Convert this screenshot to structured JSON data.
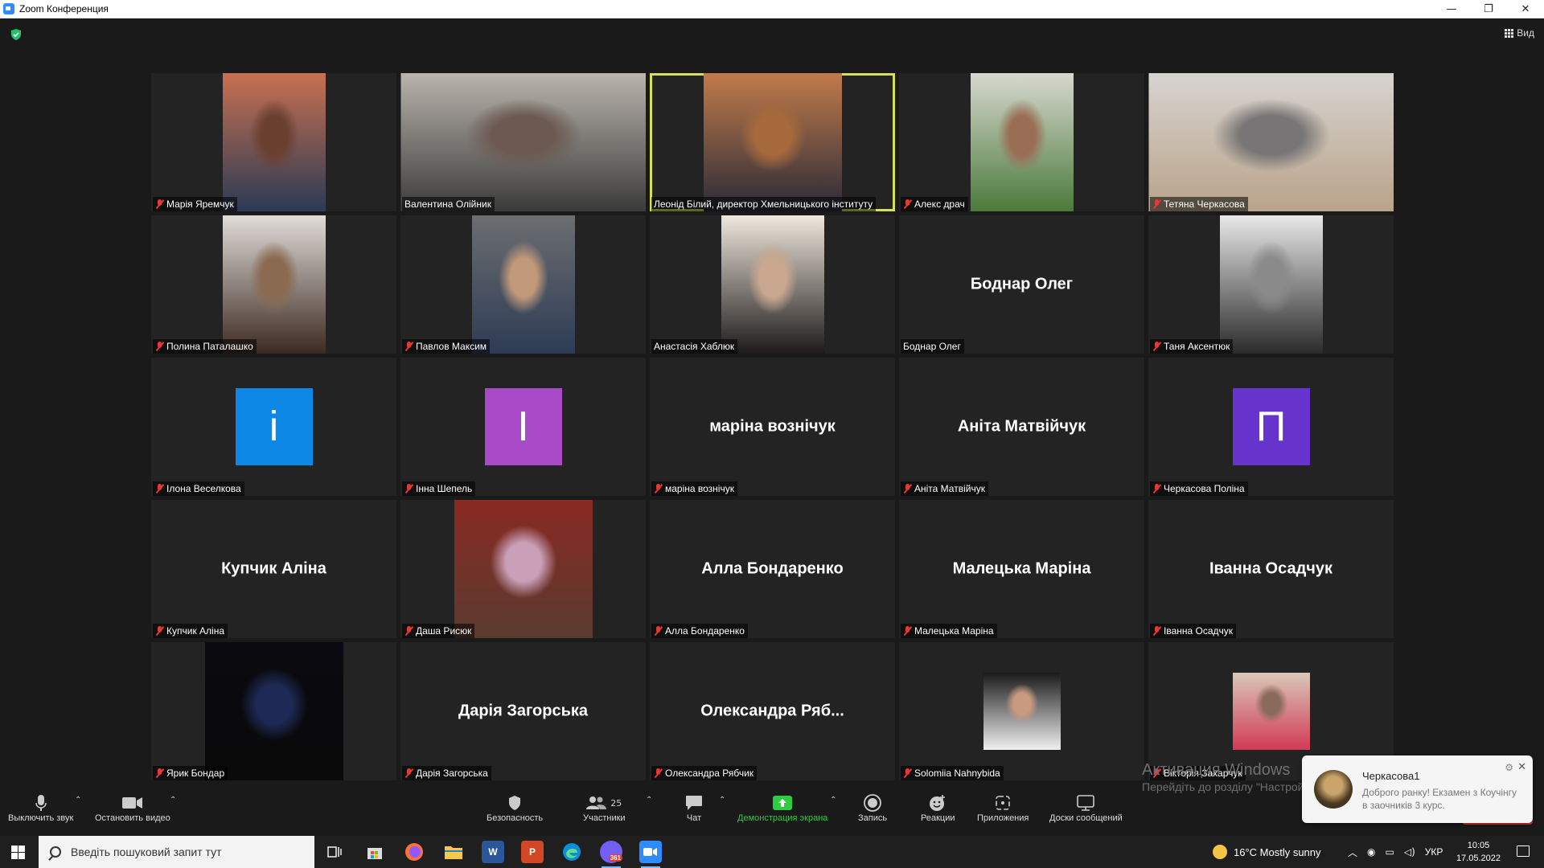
{
  "window": {
    "title": "Zoom Конференция",
    "controls": [
      "—",
      "❐",
      "✕"
    ]
  },
  "view_button": {
    "label": "Вид"
  },
  "participants": [
    {
      "name": "Марія Яремчук",
      "muted": true,
      "type": "video",
      "bg": [
        "#c87050",
        "#6a4030",
        "#2b3a55"
      ]
    },
    {
      "name": "Валентина Олійник",
      "muted": false,
      "type": "video-wide",
      "bg": [
        "#b9b4ac",
        "#6c5a52",
        "#3b3b3b"
      ]
    },
    {
      "name": "Леонід Білий, директор Хмельницького інституту",
      "muted": false,
      "type": "video-mid",
      "active": true,
      "bg": [
        "#c27b4a",
        "#a76a3c",
        "#2a2a38"
      ]
    },
    {
      "name": "Алекс драч",
      "muted": true,
      "type": "video",
      "bg": [
        "#d8d8d0",
        "#9a6e55",
        "#4b7a3b"
      ]
    },
    {
      "name": "Тетяна Черкасова",
      "muted": true,
      "type": "video-wide",
      "bg": [
        "#d7d4d0",
        "#777575",
        "#b9a38a"
      ]
    },
    {
      "name": "Полина Паталашко",
      "muted": true,
      "type": "video",
      "bg": [
        "#e0dcd8",
        "#8a6a50",
        "#3c2a22"
      ]
    },
    {
      "name": "Павлов Максим",
      "muted": true,
      "type": "video",
      "bg": [
        "#6c6e70",
        "#c29a7a",
        "#2d3b55"
      ]
    },
    {
      "name": "Анастасія Хаблюк",
      "muted": false,
      "type": "video",
      "bg": [
        "#efe8dd",
        "#c9a88f",
        "#1d1a1a"
      ]
    },
    {
      "name": "Боднар Олег",
      "muted": false,
      "type": "name",
      "display": "Боднар Олег"
    },
    {
      "name": "Таня Аксентюк",
      "muted": true,
      "type": "video",
      "bg": [
        "#e8e8e8",
        "#8a8a8a",
        "#2a2a2a"
      ]
    },
    {
      "name": "Ілона Веселкова",
      "muted": true,
      "type": "avatar",
      "letter": "і",
      "color": "#0e88e6"
    },
    {
      "name": "Інна Шепель",
      "muted": true,
      "type": "avatar",
      "letter": "І",
      "color": "#a94ac9"
    },
    {
      "name": "маріна вознічук",
      "muted": true,
      "type": "name",
      "display": "маріна вознічук"
    },
    {
      "name": "Аніта Матвійчук",
      "muted": true,
      "type": "name",
      "display": "Аніта Матвійчук"
    },
    {
      "name": "Черкасова Поліна",
      "muted": true,
      "type": "avatar",
      "letter": "П",
      "color": "#6633cc"
    },
    {
      "name": "Купчик Аліна",
      "muted": true,
      "type": "name",
      "display": "Купчик Аліна"
    },
    {
      "name": "Даша Рисюк",
      "muted": true,
      "type": "video-mid",
      "bg": [
        "#8a2a22",
        "#caa0b8",
        "#5a3a30"
      ]
    },
    {
      "name": "Алла Бондаренко",
      "muted": true,
      "type": "name",
      "display": "Алла Бондаренко"
    },
    {
      "name": "Малецька Маріна",
      "muted": true,
      "type": "name",
      "display": "Малецька Маріна"
    },
    {
      "name": "Іванна Осадчук",
      "muted": true,
      "type": "name",
      "display": "Іванна Осадчук"
    },
    {
      "name": "Ярик Бондар",
      "muted": true,
      "type": "video-mid",
      "bg": [
        "#0a0a10",
        "#1e2a55",
        "#0a0a0a"
      ]
    },
    {
      "name": "Дарія Загорська",
      "muted": true,
      "type": "name",
      "display": "Дарія Загорська"
    },
    {
      "name": "Олександра Рябчик",
      "muted": true,
      "type": "name",
      "display": "Олександра Ряб..."
    },
    {
      "name": "Solomiia Nahnybida",
      "muted": true,
      "type": "photo",
      "bg": [
        "#1a1a1a",
        "#f0f0f0",
        "#c99a80"
      ]
    },
    {
      "name": "Вікторія Захарчук",
      "muted": true,
      "type": "photo",
      "bg": [
        "#d8c8b8",
        "#d23a55",
        "#8a6a5a"
      ]
    }
  ],
  "toolbar": {
    "mute": "Выключить звук",
    "stop_video": "Остановить видео",
    "security": "Безопасность",
    "participants": "Участники",
    "participants_count": "25",
    "chat": "Чат",
    "share": "Демонстрация экрана",
    "record": "Запись",
    "reactions": "Реакции",
    "apps": "Приложения",
    "whiteboards": "Доски сообщений"
  },
  "watermark": {
    "line1": "Активация Windows",
    "line2": "Перейдіть до розділу \"Настройки\", щоб активувати Windows."
  },
  "notification": {
    "title": "Черкасова1",
    "message": "Доброго ранку! Екзамен з Коучінгу в заочників 3 курс."
  },
  "taskbar": {
    "search_placeholder": "Введіть пошуковий запит тут",
    "weather": "16°C  Mostly sunny",
    "lang": "УКР",
    "time": "10:05",
    "date": "17.05.2022",
    "viber_badge": "361"
  },
  "colors": {
    "accent_green": "#2ecc40",
    "active_border": "#d4e157",
    "muted_red": "#e53935"
  }
}
